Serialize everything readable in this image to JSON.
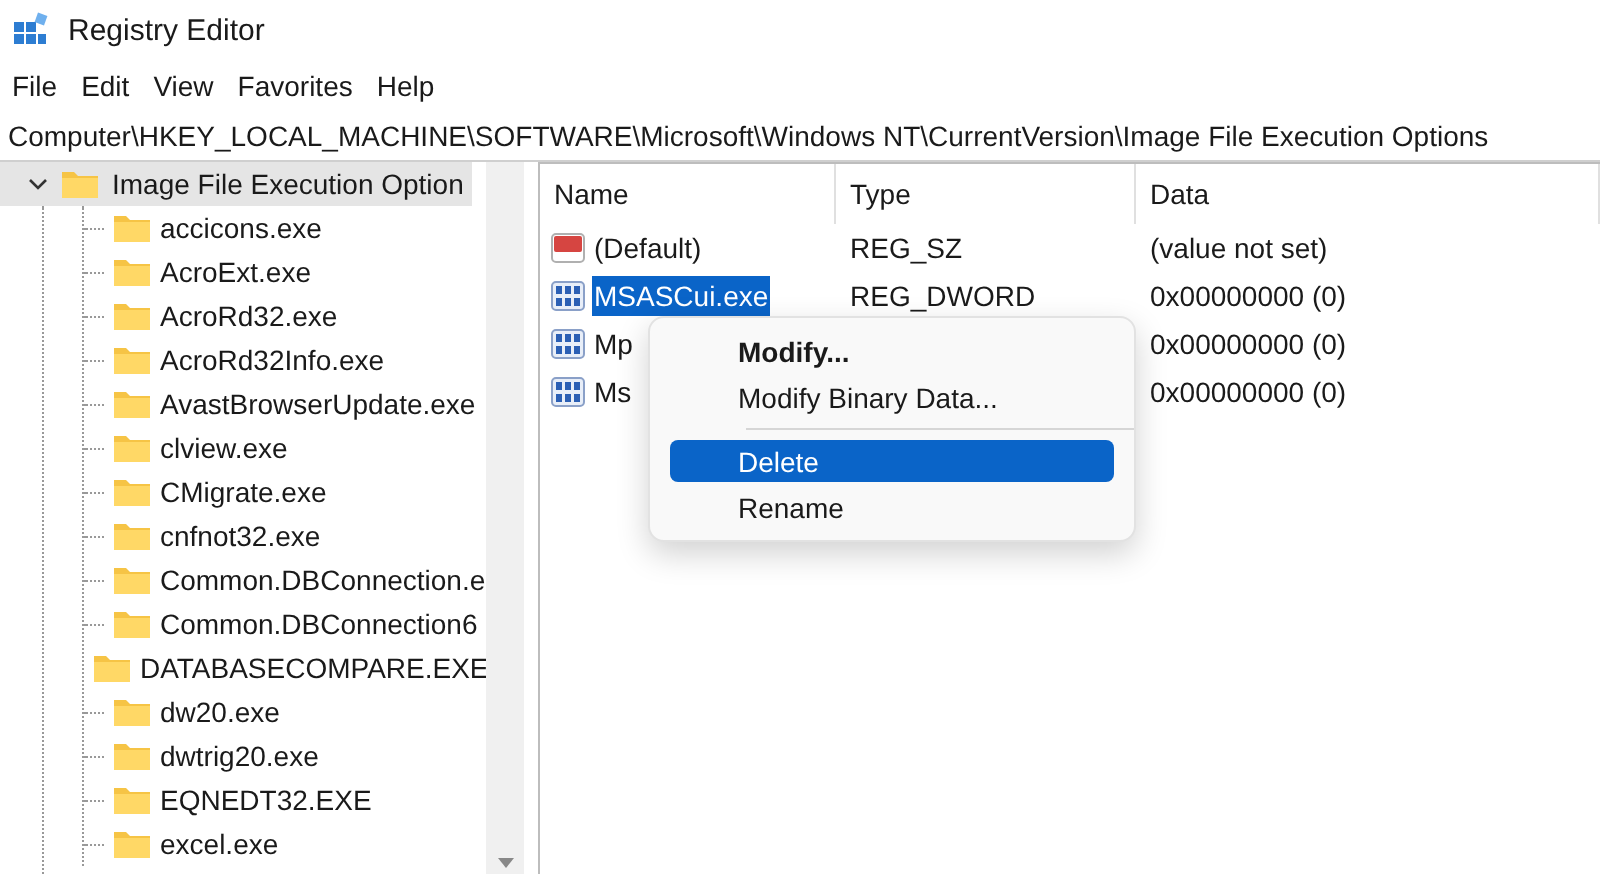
{
  "window": {
    "title": "Registry Editor"
  },
  "menu_bar": [
    "File",
    "Edit",
    "View",
    "Favorites",
    "Help"
  ],
  "address_bar": "Computer\\HKEY_LOCAL_MACHINE\\SOFTWARE\\Microsoft\\Windows NT\\CurrentVersion\\Image File Execution Options",
  "tree": {
    "items": [
      {
        "label": "Image File Execution Option",
        "expanded": true,
        "selected": true,
        "children": [
          {
            "label": "accicons.exe",
            "selected": false
          },
          {
            "label": "AcroExt.exe",
            "selected": false
          },
          {
            "label": "AcroRd32.exe",
            "selected": false
          },
          {
            "label": "AcroRd32Info.exe",
            "selected": false
          },
          {
            "label": "AvastBrowserUpdate.exe",
            "selected": false
          },
          {
            "label": "clview.exe",
            "selected": false
          },
          {
            "label": "CMigrate.exe",
            "selected": false
          },
          {
            "label": "cnfnot32.exe",
            "selected": false
          },
          {
            "label": "Common.DBConnection.e",
            "selected": false
          },
          {
            "label": "Common.DBConnection6",
            "selected": false
          },
          {
            "label": "DATABASECOMPARE.EXE",
            "selected": false
          },
          {
            "label": "dw20.exe",
            "selected": false
          },
          {
            "label": "dwtrig20.exe",
            "selected": false
          },
          {
            "label": "EQNEDT32.EXE",
            "selected": false
          },
          {
            "label": "excel.exe",
            "selected": false
          }
        ]
      }
    ]
  },
  "values_list": {
    "columns": [
      "Name",
      "Type",
      "Data"
    ],
    "rows": [
      {
        "kind": "string",
        "name": "(Default)",
        "type": "REG_SZ",
        "data": "(value not set)",
        "selected": false
      },
      {
        "kind": "binary",
        "name": "MSASCui.exe",
        "type": "REG_DWORD",
        "data": "0x00000000 (0)",
        "selected": true
      },
      {
        "kind": "binary",
        "name": "Mp",
        "data": "0x00000000 (0)",
        "selected": false
      },
      {
        "kind": "binary",
        "name": "Ms",
        "data": "0x00000000 (0)",
        "selected": false
      }
    ]
  },
  "context_menu": {
    "items": [
      {
        "kind": "item",
        "label": "Modify...",
        "default": true,
        "selected": false
      },
      {
        "kind": "item",
        "label": "Modify Binary Data...",
        "default": false,
        "selected": false
      },
      {
        "kind": "separator"
      },
      {
        "kind": "item",
        "label": "Delete",
        "default": false,
        "selected": true
      },
      {
        "kind": "item",
        "label": "Rename",
        "default": false,
        "selected": false
      }
    ]
  }
}
